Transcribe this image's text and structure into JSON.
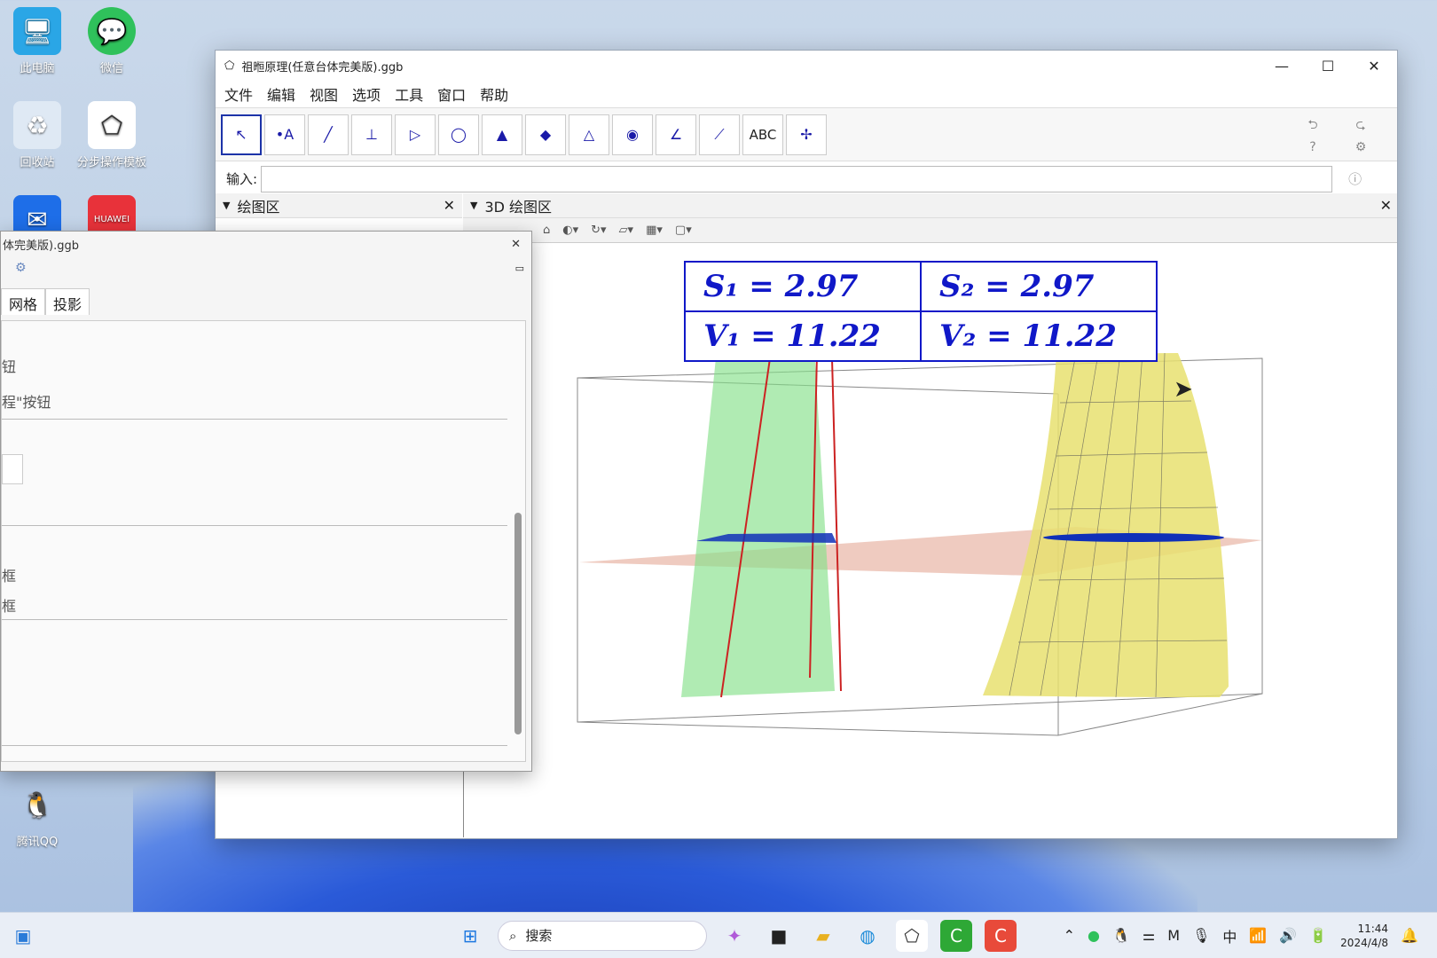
{
  "desktop": {
    "icons": [
      {
        "label": "此电脑",
        "icon": "computer-icon"
      },
      {
        "label": "微信",
        "icon": "wechat-icon"
      },
      {
        "label": "回收站",
        "icon": "recycle-bin-icon"
      },
      {
        "label": "分步操作模板",
        "icon": "geogebra-icon"
      },
      {
        "label": "HUAWEI",
        "icon": "huawei-icon"
      },
      {
        "label": "腾讯QQ",
        "icon": "qq-icon"
      }
    ]
  },
  "window": {
    "title": "祖暅原理(任意台体完美版).ggb",
    "controls": {
      "minimize": "—",
      "maximize": "☐",
      "close": "✕"
    },
    "menu": [
      "文件",
      "编辑",
      "视图",
      "选项",
      "工具",
      "窗口",
      "帮助"
    ],
    "toolbar": {
      "tools": [
        "move-tool",
        "point-tool",
        "line-tool",
        "perpendicular-tool",
        "polygon-tool",
        "circle-axis-tool",
        "cone-tool",
        "plane-tool",
        "pyramid-tool",
        "sphere-tool",
        "angle-tool",
        "reflect-tool",
        "text-tool",
        "rotate-view-tool"
      ],
      "text_tool_label": "ABC",
      "undo": "⮌",
      "redo": "⮎",
      "help": "?",
      "settings": "⚙"
    },
    "input_bar": {
      "label": "输入:",
      "value": ""
    },
    "panels": {
      "graphics": "绘图区",
      "graphics3d": "3D 绘图区"
    },
    "formula_table": {
      "s1": "S₁ = 2.97",
      "s2": "S₂ = 2.97",
      "v1": "V₁ = 11.22",
      "v2": "V₂ = 11.22"
    }
  },
  "dialog": {
    "title": "体完美版).ggb",
    "tabs": [
      "网格",
      "投影"
    ],
    "lines": [
      "钮",
      "程\"按钮",
      "框",
      "框"
    ]
  },
  "taskbar": {
    "search_placeholder": "搜索",
    "clock_time": "11:44",
    "clock_date": "2024/4/8",
    "ime": "中"
  },
  "colors": {
    "formula_blue": "#1018c8",
    "prism_green": "#86e08a",
    "surface_yellow": "#e8e070",
    "plane_pink": "#e2a08c"
  }
}
